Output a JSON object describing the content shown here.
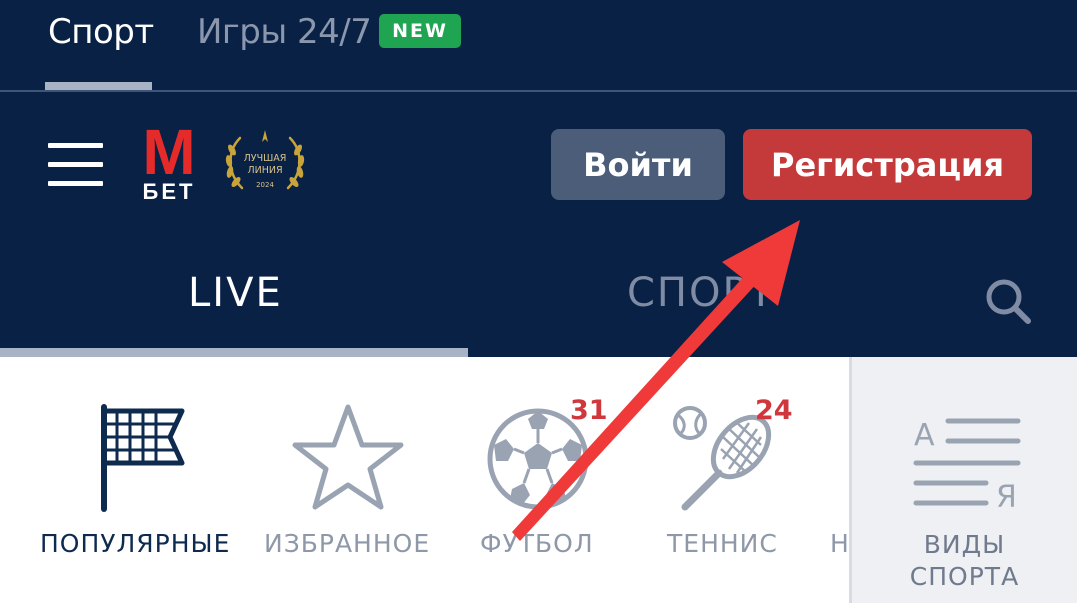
{
  "top_tabs": {
    "sport": "Спорт",
    "games": "Игры 24/7",
    "games_badge": "NEW"
  },
  "header": {
    "logo_letter": "M",
    "logo_word": "БЕТ",
    "award_line1": "ЛУЧШАЯ",
    "award_line2": "ЛИНИЯ",
    "award_year": "2024",
    "login_label": "Войти",
    "register_label": "Регистрация"
  },
  "mode_tabs": {
    "live": "LIVE",
    "sport": "СПОРТ"
  },
  "categories": [
    {
      "label": "ПОПУЛЯРНЫЕ",
      "icon": "flag-icon",
      "count": ""
    },
    {
      "label": "ИЗБРАННОЕ",
      "icon": "star-icon",
      "count": ""
    },
    {
      "label": "ФУТБОЛ",
      "icon": "soccer-ball-icon",
      "count": "31"
    },
    {
      "label": "ТЕННИС",
      "icon": "tennis-icon",
      "count": "24"
    },
    {
      "label": "Н",
      "icon": "",
      "count": ""
    }
  ],
  "all_sports": {
    "line1": "ВИДЫ",
    "line2": "СПОРТА",
    "letter_a": "А",
    "letter_ya": "Я"
  },
  "colors": {
    "navy": "#0a2146",
    "register_red": "#c43a3a",
    "login_gray": "#4b5d79",
    "new_green": "#1fa451",
    "count_red": "#d0373c",
    "annotation_arrow": "#f03a3a"
  }
}
